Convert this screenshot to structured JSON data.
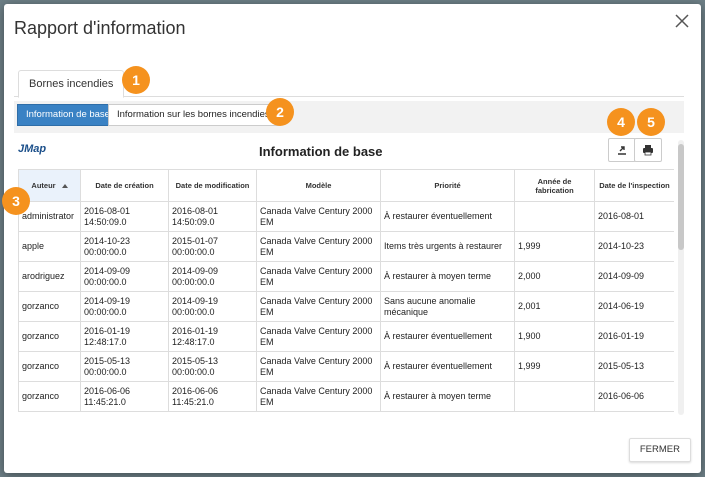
{
  "dialog": {
    "title": "Rapport d'information",
    "close_label": "×",
    "footer_button": "FERMER"
  },
  "tabs": [
    {
      "label": "Bornes incendies"
    }
  ],
  "subtabs": [
    {
      "label": "Information de base",
      "active": true
    },
    {
      "label": "Information sur les bornes incendies",
      "active": false
    }
  ],
  "badges": [
    "1",
    "2",
    "3",
    "4",
    "5"
  ],
  "report": {
    "logo": "JMap",
    "title": "Information de base"
  },
  "table": {
    "columns": [
      "Auteur",
      "Date de création",
      "Date de modification",
      "Modèle",
      "Priorité",
      "Année de fabrication",
      "Date de l'inspection"
    ],
    "rows": [
      [
        "administrator",
        "2016-08-01 14:50:09.0",
        "2016-08-01 14:50:09.0",
        "Canada Valve Century 2000 EM",
        "À restaurer éventuellement",
        "",
        "2016-08-01"
      ],
      [
        "apple",
        "2014-10-23 00:00:00.0",
        "2015-01-07 00:00:00.0",
        "Canada Valve Century 2000 EM",
        "Items très urgents à restaurer",
        "1,999",
        "2014-10-23"
      ],
      [
        "arodriguez",
        "2014-09-09 00:00:00.0",
        "2014-09-09 00:00:00.0",
        "Canada Valve Century 2000 EM",
        "À restaurer à moyen terme",
        "2,000",
        "2014-09-09"
      ],
      [
        "gorzanco",
        "2014-09-19 00:00:00.0",
        "2014-09-19 00:00:00.0",
        "Canada Valve Century 2000 EM",
        "Sans aucune anomalie mécanique",
        "2,001",
        "2014-06-19"
      ],
      [
        "gorzanco",
        "2016-01-19 12:48:17.0",
        "2016-01-19 12:48:17.0",
        "Canada Valve Century 2000 EM",
        "À restaurer éventuellement",
        "1,900",
        "2016-01-19"
      ],
      [
        "gorzanco",
        "2015-05-13 00:00:00.0",
        "2015-05-13 00:00:00.0",
        "Canada Valve Century 2000 EM",
        "À restaurer éventuellement",
        "1,999",
        "2015-05-13"
      ],
      [
        "gorzanco",
        "2016-06-06 11:45:21.0",
        "2016-06-06 11:45:21.0",
        "Canada Valve Century 2000 EM",
        "À restaurer à moyen terme",
        "",
        "2016-06-06"
      ]
    ]
  },
  "colors": {
    "badge": "#f5921e",
    "active_tab": "#3a82c4"
  }
}
